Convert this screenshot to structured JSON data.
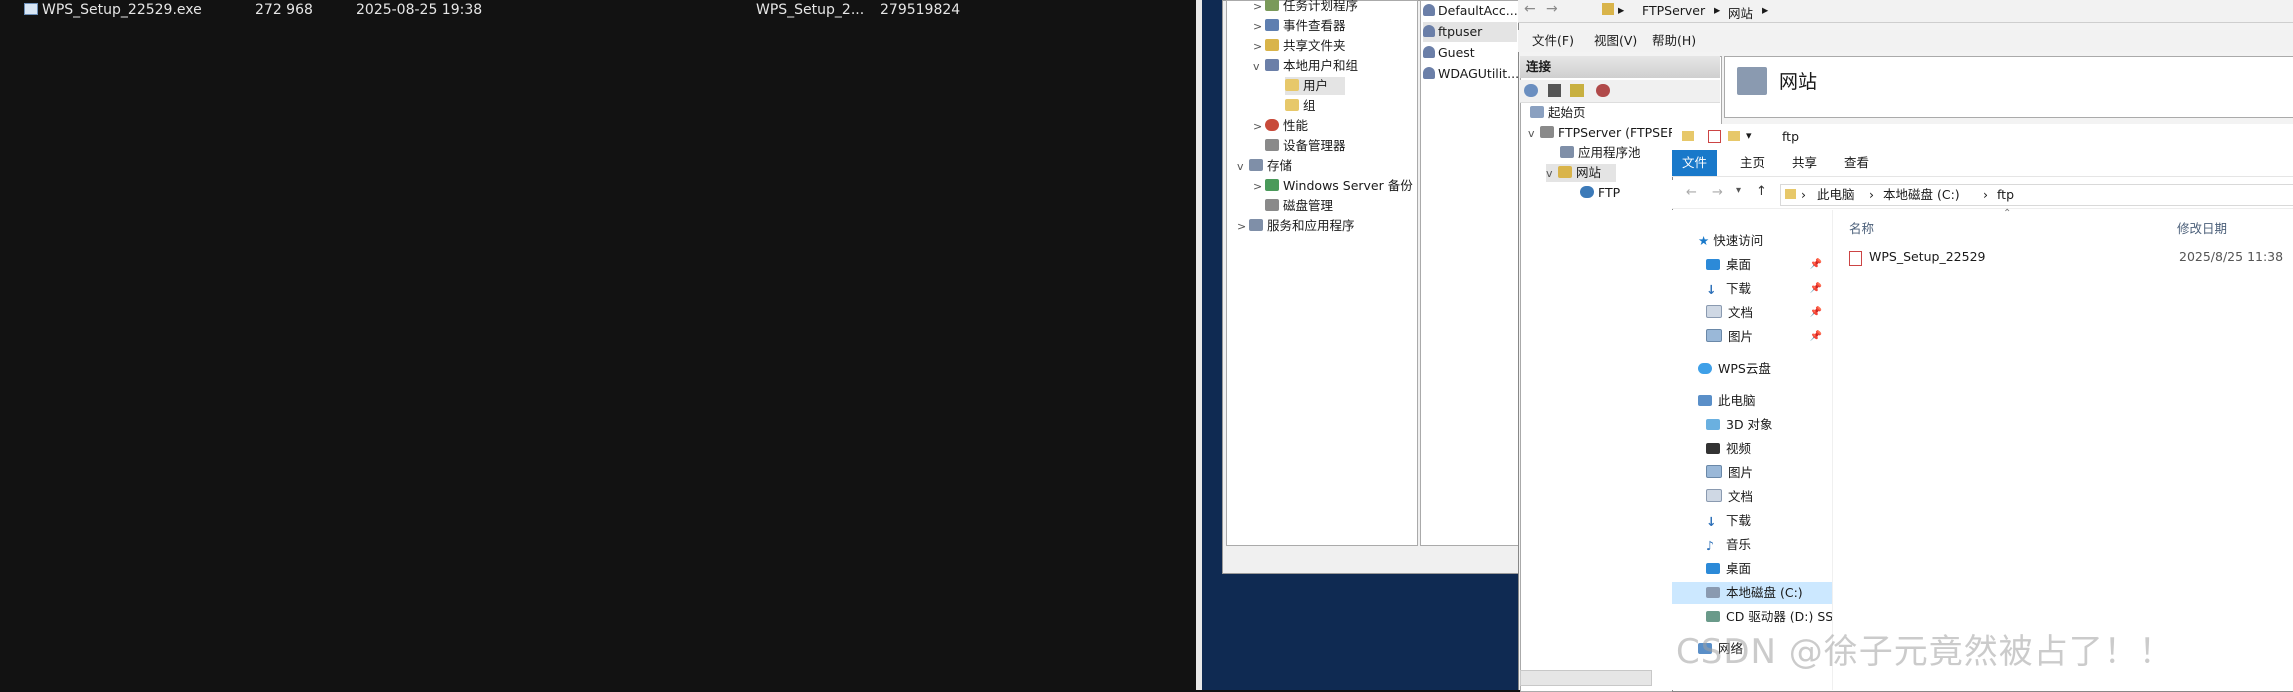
{
  "ftp_client": {
    "rows": [
      {
        "name": "WPS_Setup_22529.exe",
        "size": "272 968",
        "date": "2025-08-25 19:38",
        "remote_name": "WPS_Setup_2...",
        "remote_size": "279519824"
      }
    ]
  },
  "computer_management": {
    "tree": [
      {
        "label": "任务计划程序",
        "caret": ">"
      },
      {
        "label": "事件查看器",
        "caret": ">"
      },
      {
        "label": "共享文件夹",
        "caret": ">"
      },
      {
        "label": "本地用户和组",
        "caret": "v"
      },
      {
        "label": "用户",
        "caret": ""
      },
      {
        "label": "组",
        "caret": ""
      },
      {
        "label": "性能",
        "caret": ">"
      },
      {
        "label": "设备管理器",
        "caret": ""
      },
      {
        "label": "存储",
        "caret": "v"
      },
      {
        "label": "Windows Server 备份",
        "caret": ">"
      },
      {
        "label": "磁盘管理",
        "caret": ""
      },
      {
        "label": "服务和应用程序",
        "caret": ">"
      }
    ],
    "users": [
      "DefaultAcc...",
      "ftpuser",
      "Guest",
      "WDAGUtilit..."
    ]
  },
  "iis": {
    "breadcrumb": [
      "FTPServer",
      "网站"
    ],
    "menu": [
      "文件(F)",
      "视图(V)",
      "帮助(H)"
    ],
    "connections_title": "连接",
    "tree": [
      "起始页",
      "FTPServer (FTPSER",
      "应用程序池",
      "网站",
      "FTP"
    ],
    "site_title": "网站"
  },
  "explorer": {
    "title": "ftp",
    "ribbon_tabs": [
      "文件",
      "主页",
      "共享",
      "查看"
    ],
    "address": [
      "此电脑",
      "本地磁盘 (C:)",
      "ftp"
    ],
    "sidebar": [
      {
        "label": "快速访问",
        "pinned": false
      },
      {
        "label": "桌面",
        "pinned": true
      },
      {
        "label": "下载",
        "pinned": true
      },
      {
        "label": "文档",
        "pinned": true
      },
      {
        "label": "图片",
        "pinned": true
      },
      {
        "label": "WPS云盘",
        "pinned": false
      },
      {
        "label": "此电脑",
        "pinned": false
      },
      {
        "label": "3D 对象",
        "pinned": false
      },
      {
        "label": "视频",
        "pinned": false
      },
      {
        "label": "图片",
        "pinned": false
      },
      {
        "label": "文档",
        "pinned": false
      },
      {
        "label": "下载",
        "pinned": false
      },
      {
        "label": "音乐",
        "pinned": false
      },
      {
        "label": "桌面",
        "pinned": false
      },
      {
        "label": "本地磁盘 (C:)",
        "pinned": false
      },
      {
        "label": "CD 驱动器 (D:) SSS",
        "pinned": false
      },
      {
        "label": "网络",
        "pinned": false
      }
    ],
    "columns": {
      "name": "名称",
      "modified": "修改日期"
    },
    "files": [
      {
        "name": "WPS_Setup_22529",
        "modified": "2025/8/25 11:38"
      }
    ]
  },
  "watermark": "CSDN @徐子元竟然被占了！！",
  "colors": {
    "accent": "#1979ca",
    "desktop": "#0f2a52",
    "dark_bg": "#121212"
  }
}
